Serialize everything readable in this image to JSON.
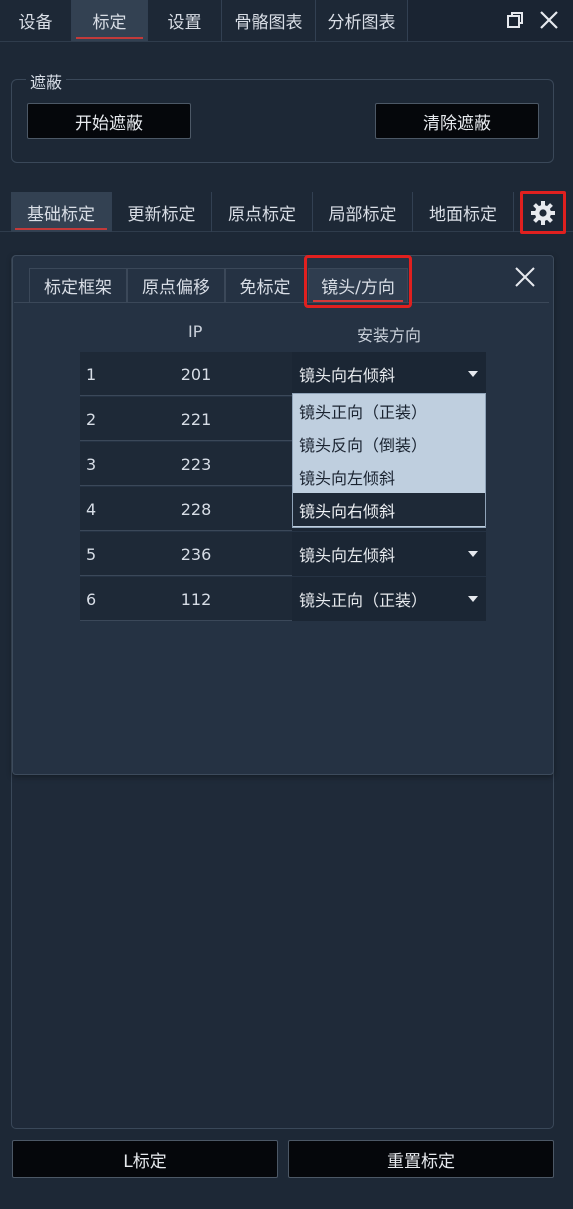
{
  "top_tabs": [
    "设备",
    "标定",
    "设置",
    "骨骼图表",
    "分析图表"
  ],
  "top_active": "标定",
  "mask": {
    "title": "遮蔽",
    "start_label": "开始遮蔽",
    "clear_label": "清除遮蔽"
  },
  "sub_tabs": [
    "基础标定",
    "更新标定",
    "原点标定",
    "局部标定",
    "地面标定"
  ],
  "sub_active": "基础标定",
  "dialog": {
    "tabs": [
      "标定框架",
      "原点偏移",
      "免标定",
      "镜头/方向"
    ],
    "active_tab": "镜头/方向",
    "table": {
      "headers": {
        "ip": "IP",
        "direction": "安装方向"
      },
      "rows": [
        {
          "num": "1",
          "ip": "201",
          "direction": "镜头向右倾斜"
        },
        {
          "num": "2",
          "ip": "221",
          "direction": ""
        },
        {
          "num": "3",
          "ip": "223",
          "direction": ""
        },
        {
          "num": "4",
          "ip": "228",
          "direction": ""
        },
        {
          "num": "5",
          "ip": "236",
          "direction": "镜头向左倾斜"
        },
        {
          "num": "6",
          "ip": "112",
          "direction": "镜头正向（正装）"
        }
      ]
    },
    "dropdown_options": [
      "镜头正向（正装）",
      "镜头反向（倒装）",
      "镜头向左倾斜",
      "镜头向右倾斜"
    ],
    "dropdown_selected": "镜头向右倾斜"
  },
  "bottom": {
    "l_calib_label": "L标定",
    "reset_label": "重置标定"
  },
  "colors": {
    "background": "#1d2836",
    "highlight_red": "#e0201f",
    "dropdown_bg": "#bfcfdf"
  },
  "icons": {
    "restore": "restore-window-icon",
    "close": "close-icon",
    "settings": "gear-icon",
    "dropdown": "caret-down-icon"
  }
}
